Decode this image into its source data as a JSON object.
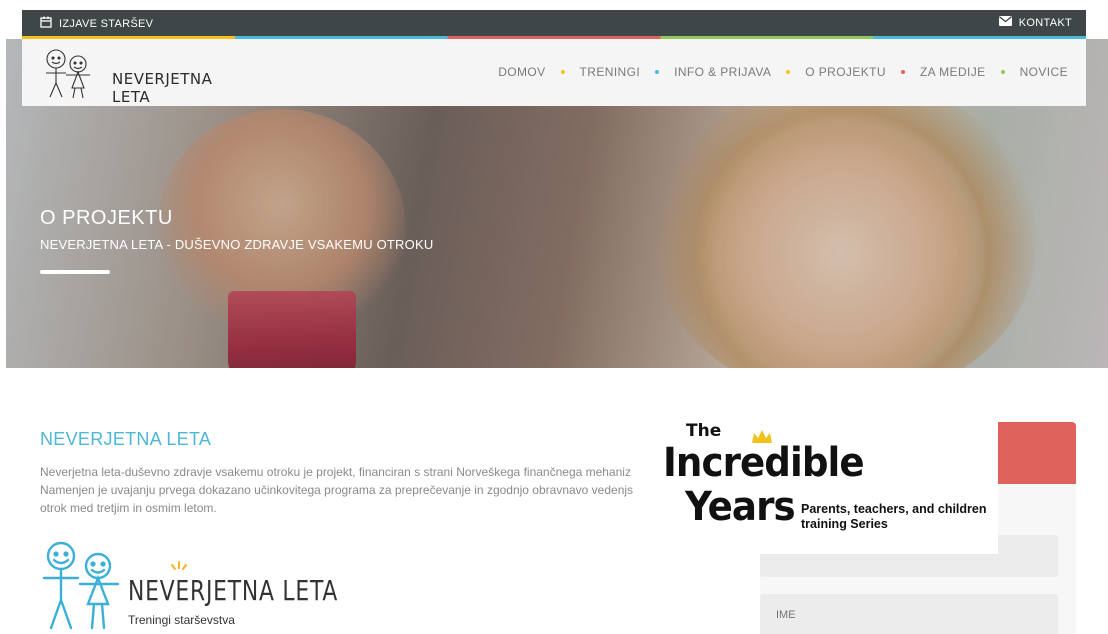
{
  "topbar": {
    "left_label": "IZJAVE STARŠEV",
    "left_icon": "calendar-icon",
    "right_label": "KONTAKT",
    "right_icon": "envelope-icon"
  },
  "brand": {
    "name": "NEVERJETNA LETA"
  },
  "nav": {
    "items": [
      {
        "label": "DOMOV",
        "dot_color": "#f7c11b"
      },
      {
        "label": "TRENINGI",
        "dot_color": "#48bcd6"
      },
      {
        "label": "INFO & PRIJAVA",
        "dot_color": "#f7c11b"
      },
      {
        "label": "O PROJEKTU",
        "dot_color": "#e0625d"
      },
      {
        "label": "ZA MEDIJE",
        "dot_color": "#93c65c"
      },
      {
        "label": "NOVICE",
        "dot_color": ""
      }
    ]
  },
  "hero": {
    "title": "O PROJEKTU",
    "subtitle": "NEVERJETNA LETA - DUŠEVNO ZDRAVJE VSAKEMU OTROKU"
  },
  "content": {
    "title": "NEVERJETNA LETA",
    "lines": [
      "Neverjetna leta-duševno zdravje vsakemu otroku je projekt, financiran s strani Norveškega finančnega mehaniz",
      "Namenjen je uvajanju prvega dokazano učinkovitega programa za preprečevanje in zgodnjo obravnavo vedenjs",
      "otrok med tretjim in osmim letom."
    ]
  },
  "logo2": {
    "name": "NEVERJETNA LETA",
    "subtitle": "Treningi starševstva"
  },
  "incredible_years": {
    "the": "The",
    "incredible": "Incredible",
    "years": "Years",
    "series_line1": "Parents, teachers, and children",
    "series_line2": "training Series"
  },
  "form": {
    "field1_placeholder": "",
    "field2_placeholder": "IME"
  },
  "colors": {
    "accent_blue": "#4cb8d4",
    "accent_red": "#e0625d",
    "topbar_bg": "#3f4647"
  }
}
